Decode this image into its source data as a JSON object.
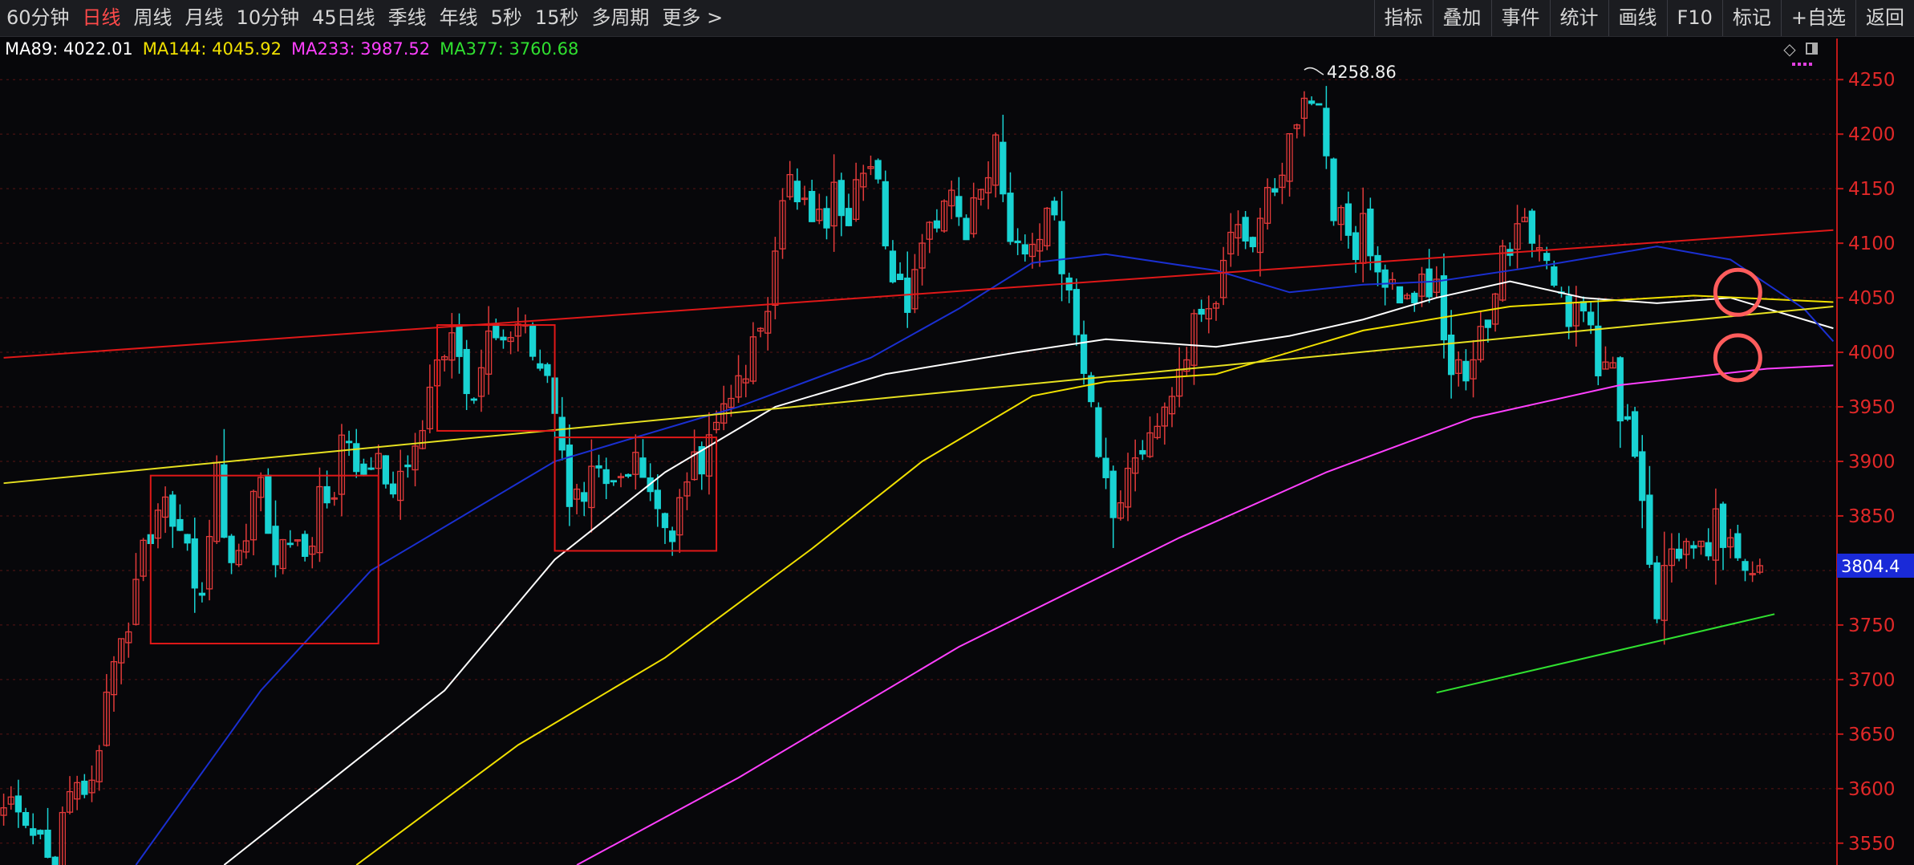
{
  "toolbar": {
    "periods": [
      "60分钟",
      "日线",
      "周线",
      "月线",
      "10分钟",
      "45日线",
      "季线",
      "年线",
      "5秒",
      "15秒",
      "多周期",
      "更多 >"
    ],
    "active_period": "日线",
    "tools": [
      "指标",
      "叠加",
      "事件",
      "统计",
      "画线",
      "F10",
      "标记",
      "+自选",
      "返回"
    ]
  },
  "ma_legend": [
    {
      "label": "MA89: 4022.01",
      "color": "#ffffff"
    },
    {
      "label": "MA144: 4045.92",
      "color": "#f0e000"
    },
    {
      "label": "MA233: 3987.52",
      "color": "#ff40ff"
    },
    {
      "label": "MA377: 3760.68",
      "color": "#30e030"
    }
  ],
  "chart_controls": {
    "diamond_icon": "diamond-icon",
    "panel_icon": "panel-toggle-icon"
  },
  "colors": {
    "background": "#07070a",
    "grid": "#5a1414",
    "axis": "#c01818",
    "tick_text": "#e02828",
    "up": "#e23a3a",
    "down": "#19d3d3",
    "ma89": "#ffffff",
    "ma144": "#f0e000",
    "ma233": "#ff40ff",
    "ma_blue": "#1a2fd0",
    "trend_red": "#e01818",
    "trend_yellow": "#e6e020",
    "trend_green": "#30e030",
    "price_tag_bg": "#1a2ad8",
    "annotation_circle": "#ff5c5c"
  },
  "chart_data": {
    "type": "candlestick",
    "y_ticks": [
      4250,
      4200,
      4150,
      4100,
      4050,
      4000,
      3950,
      3900,
      3850,
      3800,
      3750,
      3700,
      3650,
      3600,
      3550
    ],
    "ylim": [
      3530,
      4270
    ],
    "bars_visible": 250,
    "high_label": "4258.86",
    "high_value": 4258.86,
    "current_price_label": "3804.4",
    "current_price": 3804.4,
    "moving_averages": [
      {
        "name": "MA89",
        "color": "#ffffff",
        "points": [
          [
            30,
            3530
          ],
          [
            60,
            3690
          ],
          [
            75,
            3810
          ],
          [
            90,
            3890
          ],
          [
            105,
            3950
          ],
          [
            120,
            3980
          ],
          [
            138,
            4000
          ],
          [
            150,
            4012
          ],
          [
            165,
            4005
          ],
          [
            175,
            4015
          ],
          [
            185,
            4030
          ],
          [
            195,
            4050
          ],
          [
            205,
            4065
          ],
          [
            215,
            4050
          ],
          [
            225,
            4045
          ],
          [
            235,
            4050
          ],
          [
            249,
            4022
          ]
        ]
      },
      {
        "name": "MA144",
        "color": "#f0e000",
        "points": [
          [
            48,
            3530
          ],
          [
            70,
            3640
          ],
          [
            90,
            3720
          ],
          [
            110,
            3820
          ],
          [
            125,
            3900
          ],
          [
            140,
            3960
          ],
          [
            150,
            3973
          ],
          [
            165,
            3980
          ],
          [
            185,
            4020
          ],
          [
            205,
            4042
          ],
          [
            230,
            4052
          ],
          [
            249,
            4046
          ]
        ]
      },
      {
        "name": "MA233",
        "color": "#ff40ff",
        "points": [
          [
            78,
            3530
          ],
          [
            100,
            3610
          ],
          [
            130,
            3730
          ],
          [
            160,
            3830
          ],
          [
            180,
            3890
          ],
          [
            200,
            3940
          ],
          [
            220,
            3970
          ],
          [
            240,
            3985
          ],
          [
            249,
            3988
          ]
        ]
      },
      {
        "name": "MA blue",
        "color": "#1a2fd0",
        "points": [
          [
            18,
            3530
          ],
          [
            35,
            3690
          ],
          [
            50,
            3800
          ],
          [
            75,
            3900
          ],
          [
            100,
            3950
          ],
          [
            118,
            3995
          ],
          [
            130,
            4040
          ],
          [
            140,
            4082
          ],
          [
            150,
            4090
          ],
          [
            165,
            4075
          ],
          [
            175,
            4055
          ],
          [
            185,
            4062
          ],
          [
            195,
            4065
          ],
          [
            210,
            4080
          ],
          [
            225,
            4097
          ],
          [
            235,
            4085
          ],
          [
            245,
            4040
          ],
          [
            249,
            4010
          ]
        ]
      }
    ],
    "trend_lines": [
      {
        "color": "#e01818",
        "from": [
          0,
          3995
        ],
        "to": [
          249,
          4112
        ]
      },
      {
        "color": "#e6e020",
        "from": [
          0,
          3880
        ],
        "to": [
          249,
          4042
        ]
      },
      {
        "color": "#30e030",
        "from": [
          195,
          3688
        ],
        "to": [
          241,
          3760
        ]
      }
    ],
    "boxes": [
      {
        "x": [
          20,
          51
        ],
        "y": [
          3733,
          3887
        ]
      },
      {
        "x": [
          59,
          75
        ],
        "y": [
          3928,
          4025
        ]
      },
      {
        "x": [
          75,
          97
        ],
        "y": [
          3818,
          3922
        ]
      }
    ],
    "annotation_circles": [
      {
        "x": 236,
        "y": 4055
      },
      {
        "x": 236,
        "y": 3995
      }
    ],
    "price_path": [
      [
        0,
        3580
      ],
      [
        4,
        3560
      ],
      [
        6,
        3530
      ],
      [
        8,
        3560
      ],
      [
        10,
        3600
      ],
      [
        12,
        3620
      ],
      [
        14,
        3680
      ],
      [
        16,
        3720
      ],
      [
        18,
        3780
      ],
      [
        20,
        3840
      ],
      [
        22,
        3870
      ],
      [
        25,
        3830
      ],
      [
        27,
        3760
      ],
      [
        29,
        3880
      ],
      [
        31,
        3800
      ],
      [
        33,
        3840
      ],
      [
        35,
        3880
      ],
      [
        37,
        3820
      ],
      [
        39,
        3840
      ],
      [
        41,
        3800
      ],
      [
        43,
        3860
      ],
      [
        45,
        3880
      ],
      [
        47,
        3930
      ],
      [
        49,
        3880
      ],
      [
        51,
        3900
      ],
      [
        53,
        3860
      ],
      [
        55,
        3900
      ],
      [
        57,
        3940
      ],
      [
        59,
        4000
      ],
      [
        61,
        4010
      ],
      [
        63,
        3960
      ],
      [
        65,
        3990
      ],
      [
        67,
        4010
      ],
      [
        69,
        4000
      ],
      [
        71,
        4020
      ],
      [
        73,
        3970
      ],
      [
        75,
        3950
      ],
      [
        77,
        3850
      ],
      [
        79,
        3880
      ],
      [
        81,
        3900
      ],
      [
        83,
        3870
      ],
      [
        85,
        3890
      ],
      [
        87,
        3900
      ],
      [
        89,
        3860
      ],
      [
        91,
        3840
      ],
      [
        93,
        3880
      ],
      [
        95,
        3900
      ],
      [
        97,
        3930
      ],
      [
        99,
        3960
      ],
      [
        101,
        3980
      ],
      [
        103,
        4030
      ],
      [
        105,
        4080
      ],
      [
        107,
        4160
      ],
      [
        109,
        4130
      ],
      [
        111,
        4120
      ],
      [
        113,
        4140
      ],
      [
        115,
        4130
      ],
      [
        117,
        4150
      ],
      [
        119,
        4160
      ],
      [
        121,
        4070
      ],
      [
        123,
        4050
      ],
      [
        125,
        4090
      ],
      [
        127,
        4120
      ],
      [
        129,
        4130
      ],
      [
        131,
        4110
      ],
      [
        133,
        4150
      ],
      [
        135,
        4180
      ],
      [
        137,
        4100
      ],
      [
        139,
        4080
      ],
      [
        141,
        4120
      ],
      [
        143,
        4110
      ],
      [
        145,
        4060
      ],
      [
        147,
        3980
      ],
      [
        149,
        3900
      ],
      [
        151,
        3860
      ],
      [
        153,
        3890
      ],
      [
        155,
        3920
      ],
      [
        157,
        3940
      ],
      [
        159,
        3970
      ],
      [
        161,
        4010
      ],
      [
        163,
        4050
      ],
      [
        165,
        4060
      ],
      [
        167,
        4090
      ],
      [
        169,
        4110
      ],
      [
        171,
        4120
      ],
      [
        173,
        4150
      ],
      [
        175,
        4200
      ],
      [
        177,
        4240
      ],
      [
        179,
        4210
      ],
      [
        181,
        4140
      ],
      [
        183,
        4090
      ],
      [
        185,
        4110
      ],
      [
        187,
        4090
      ],
      [
        189,
        4060
      ],
      [
        191,
        4050
      ],
      [
        193,
        4060
      ],
      [
        195,
        4070
      ],
      [
        197,
        3980
      ],
      [
        199,
        3990
      ],
      [
        201,
        4010
      ],
      [
        203,
        4060
      ],
      [
        205,
        4100
      ],
      [
        207,
        4120
      ],
      [
        209,
        4080
      ],
      [
        211,
        4060
      ],
      [
        213,
        4030
      ],
      [
        215,
        4040
      ],
      [
        217,
        3980
      ],
      [
        219,
        3980
      ],
      [
        221,
        3920
      ],
      [
        223,
        3860
      ],
      [
        225,
        3760
      ],
      [
        227,
        3820
      ],
      [
        229,
        3840
      ],
      [
        231,
        3820
      ],
      [
        233,
        3840
      ],
      [
        235,
        3810
      ],
      [
        237,
        3820
      ],
      [
        239,
        3804
      ]
    ]
  }
}
